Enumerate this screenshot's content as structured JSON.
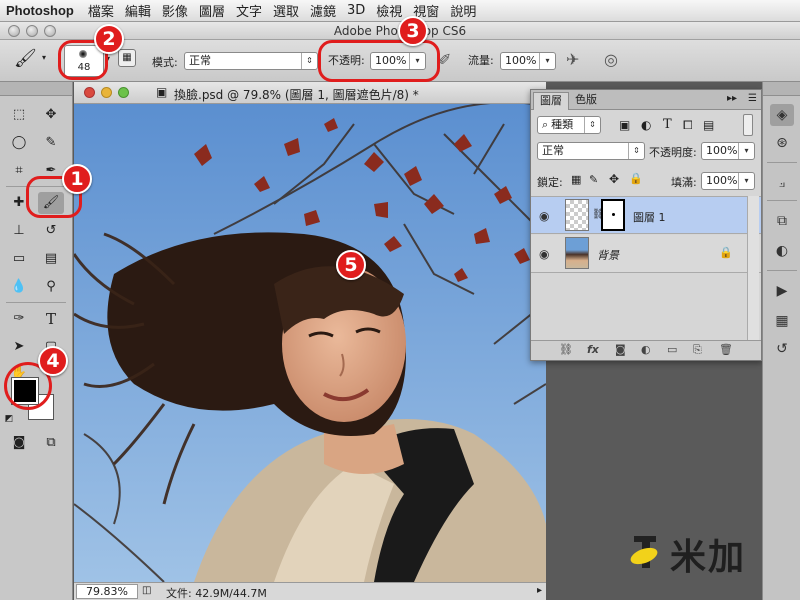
{
  "menubar": {
    "app": "Photoshop",
    "items": [
      "檔案",
      "編輯",
      "影像",
      "圖層",
      "文字",
      "選取",
      "濾鏡",
      "3D",
      "檢視",
      "視窗",
      "說明"
    ]
  },
  "window": {
    "title": "Adobe Photoshop CS6"
  },
  "options": {
    "brush_size": "48",
    "mode_label": "模式:",
    "mode_value": "正常",
    "opacity_label": "不透明:",
    "opacity_value": "100%",
    "flow_label": "流量:",
    "flow_value": "100%"
  },
  "callouts": [
    "1",
    "2",
    "3",
    "4",
    "5"
  ],
  "document": {
    "tab_title": "換臉.psd @ 79.8% (圖層 1, 圖層遮色片/8) *",
    "zoom": "79.83%",
    "file_info": "文件: 42.9M/44.7M"
  },
  "layers_panel": {
    "tab_layers": "圖層",
    "tab_channels": "色版",
    "filter_kind": "種類",
    "blend_mode": "正常",
    "opacity_label": "不透明度:",
    "opacity_value": "100%",
    "lock_label": "鎖定:",
    "fill_label": "填滿:",
    "fill_value": "100%",
    "layers": [
      {
        "name": "圖層 1",
        "selected": true
      },
      {
        "name": "背景",
        "selected": false,
        "locked": true
      }
    ]
  },
  "watermark": {
    "text": "米加"
  },
  "colors": {
    "accent_red": "#e01d1d",
    "selected_layer": "#b7cdf1",
    "sky": "#6d9fd6"
  }
}
